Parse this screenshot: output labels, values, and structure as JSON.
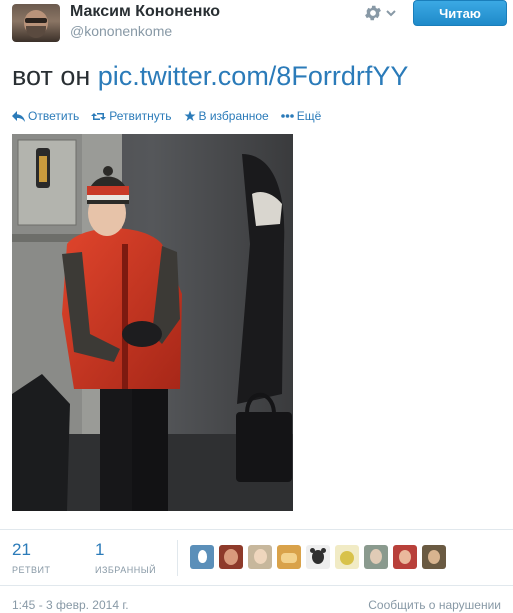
{
  "user": {
    "fullname": "Максим Кононенко",
    "username": "@kononenkome",
    "follow_label": "Читаю"
  },
  "tweet": {
    "text_prefix": "вот он ",
    "link": "pic.twitter.com/8ForrdrfYY",
    "timestamp": "1:45 - 3 февр. 2014 г.",
    "report_label": "Сообщить о нарушении"
  },
  "actions": {
    "reply": "Ответить",
    "retweet": "Ретвитнуть",
    "favorite": "В избранное",
    "more": "Ещё"
  },
  "stats": {
    "retweets": {
      "count": "21",
      "label": "РЕТВИТ"
    },
    "favorites": {
      "count": "1",
      "label": "ИЗБРАННЫЙ"
    }
  },
  "colors": {
    "link": "#2b7bb9",
    "follow_button": "#2b9fe0",
    "muted": "#8899a6"
  },
  "avatars": [
    {
      "icon": "default-egg-avatar",
      "color": "#5b8fb9"
    },
    {
      "icon": "user-avatar",
      "color": "#8e3a2a"
    },
    {
      "icon": "user-avatar",
      "color": "#c7b79c"
    },
    {
      "icon": "user-avatar",
      "color": "#d9a24a"
    },
    {
      "icon": "bear-avatar",
      "color": "#2f2f2f"
    },
    {
      "icon": "user-avatar",
      "color": "#d8c24a"
    },
    {
      "icon": "user-avatar",
      "color": "#8a9a8e"
    },
    {
      "icon": "user-avatar",
      "color": "#b8403a"
    },
    {
      "icon": "user-avatar",
      "color": "#6a5a42"
    }
  ]
}
